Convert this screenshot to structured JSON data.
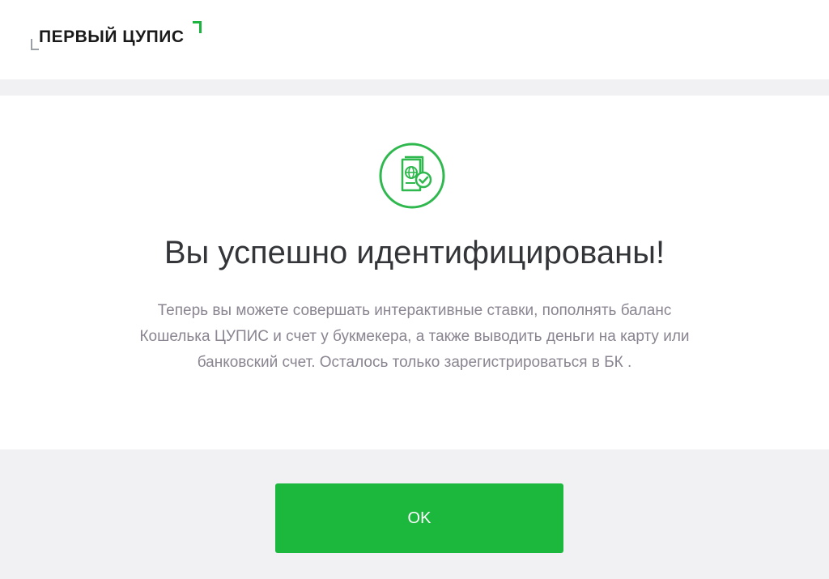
{
  "header": {
    "logo_text": "ПЕРВЫЙ ЦУПИС"
  },
  "content": {
    "icon": "passport-check-icon",
    "title": "Вы успешно идентифицированы!",
    "description": "Теперь вы можете совершать интерактивные ставки, пополнять баланс Кошелька ЦУПИС и счет у букмекера, а также выводить деньги на карту или банковский счет. Осталось только зарегистрироваться в БК ."
  },
  "footer": {
    "ok_label": "OK"
  },
  "colors": {
    "brand_green": "#1cb83e",
    "icon_green": "#2fb84d",
    "title_text": "#333538",
    "body_text": "#8a8590",
    "background": "#f1f1f3"
  }
}
